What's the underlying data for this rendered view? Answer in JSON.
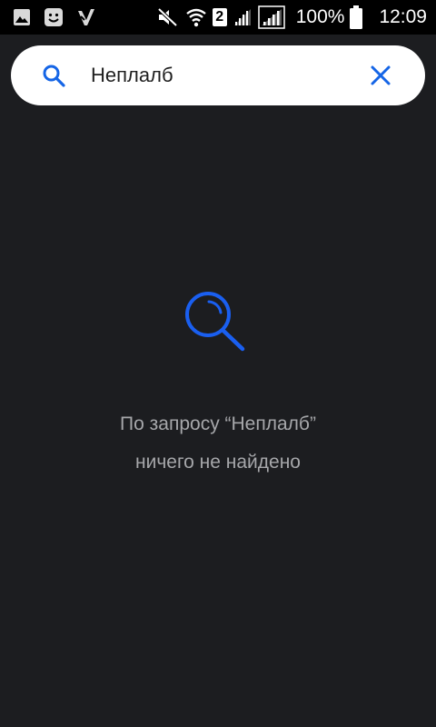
{
  "status_bar": {
    "notification_icons": [
      "gallery-icon",
      "smiley-icon",
      "check-icon"
    ],
    "mute_icon": "mute-icon",
    "wifi_icon": "wifi-icon",
    "sim_label": "2",
    "signal_icons": [
      "signal-icon",
      "signal-icon"
    ],
    "battery_percent": "100%",
    "battery_level": 1.0,
    "time": "12:09"
  },
  "search": {
    "icon": "search-icon",
    "query": "Неплалб",
    "clear_icon": "close-icon",
    "accent_color": "#1565e6"
  },
  "empty_state": {
    "icon": "search-icon",
    "line1": "По запросу “Неплалб”",
    "line2": "ничего не найдено",
    "accent_color": "#1a5ff0"
  }
}
